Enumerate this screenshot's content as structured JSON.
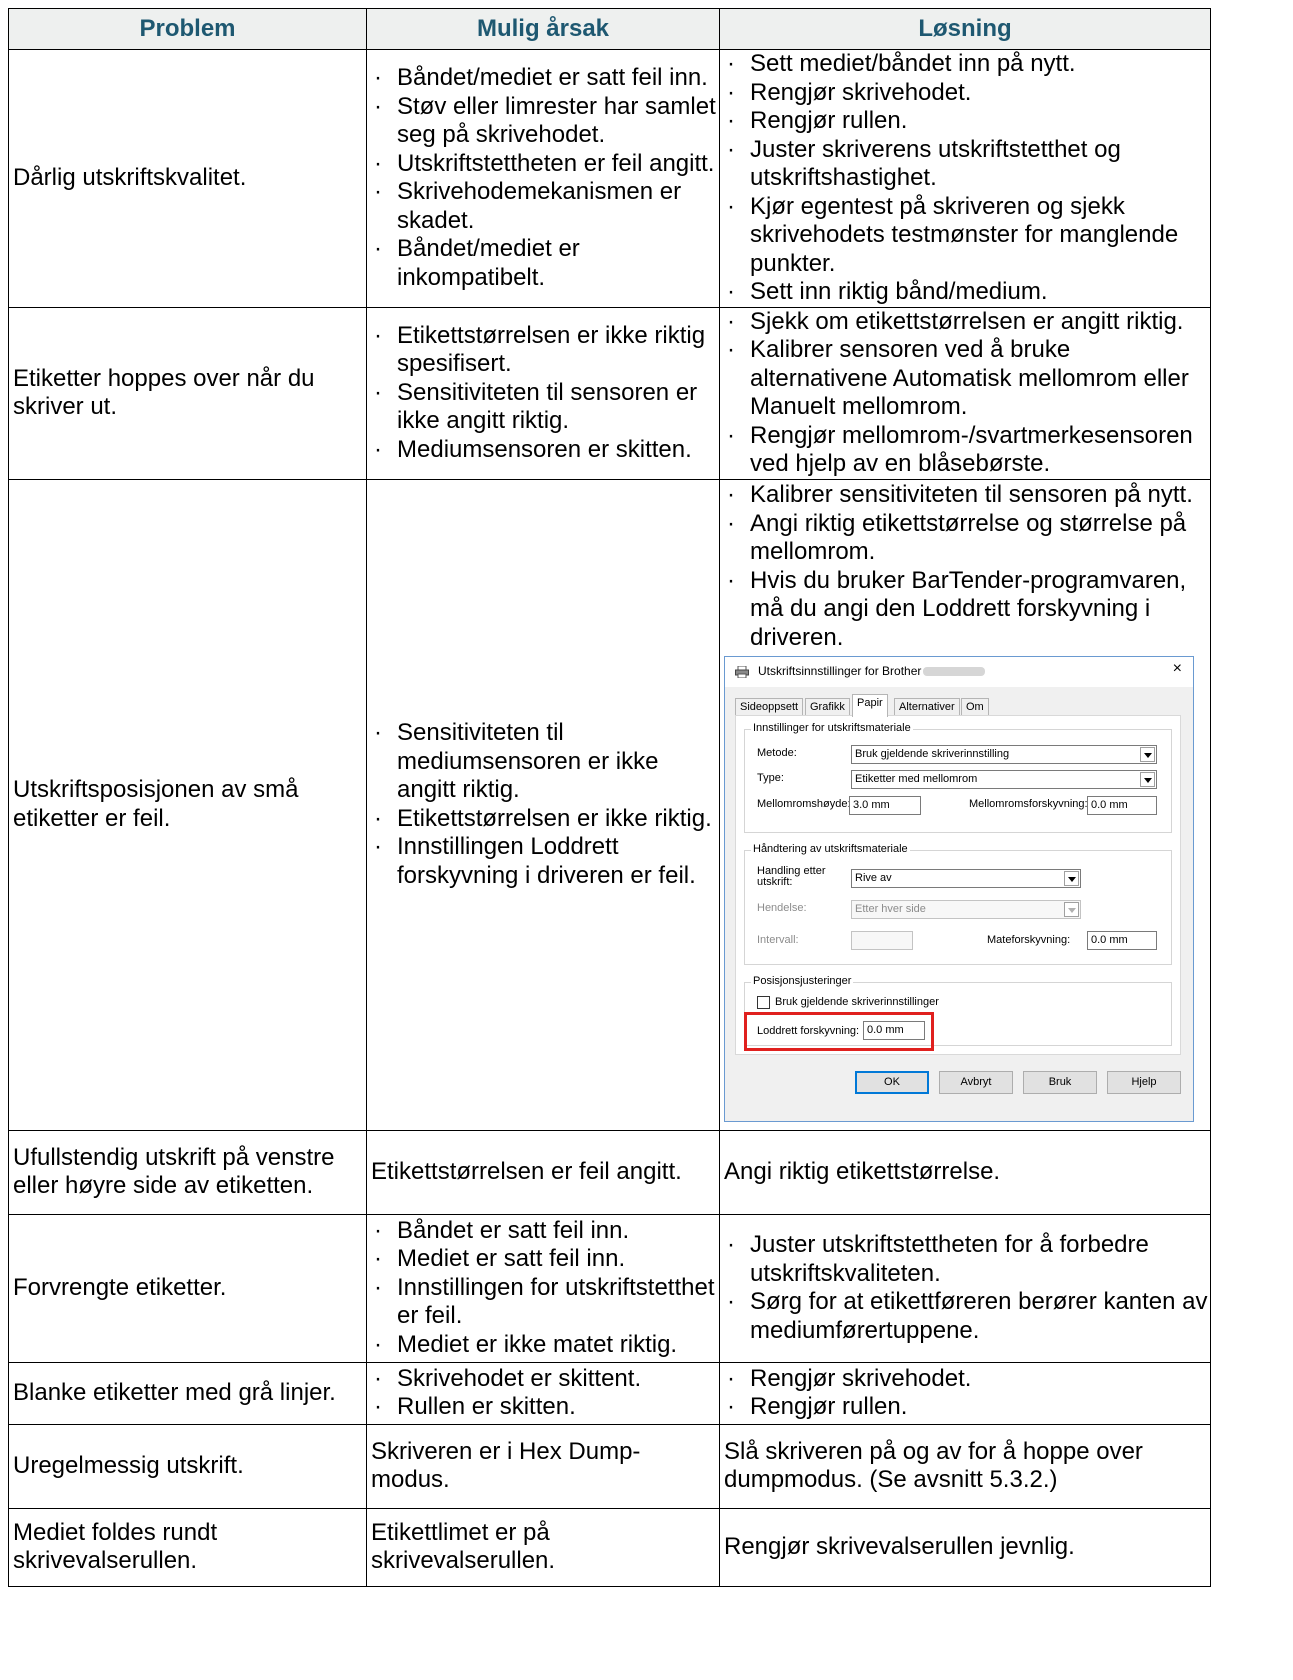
{
  "headers": {
    "problem": "Problem",
    "cause": "Mulig årsak",
    "solution": "Løsning"
  },
  "rows": [
    {
      "problem": "Dårlig utskriftskvalitet.",
      "causes": [
        "Båndet/mediet er satt feil inn.",
        "Støv eller limrester har samlet seg på skrivehodet.",
        "Utskriftstettheten er feil angitt.",
        "Skrivehodemekanismen er skadet.",
        "Båndet/mediet er inkompatibelt."
      ],
      "solutions": [
        "Sett mediet/båndet inn på nytt.",
        "Rengjør skrivehodet.",
        "Rengjør rullen.",
        "Juster skriverens utskriftstetthet og utskriftshastighet.",
        "Kjør egentest på skriveren og sjekk skrivehodets testmønster for manglende punkter.",
        "Sett inn riktig bånd/medium."
      ]
    },
    {
      "problem": "Etiketter hoppes over når du skriver ut.",
      "causes": [
        "Etikettstørrelsen er ikke riktig spesifisert.",
        "Sensitiviteten til sensoren er ikke angitt riktig.",
        "Mediumsensoren er skitten."
      ],
      "solutions": [
        "Sjekk om etikettstørrelsen er angitt riktig.",
        "Kalibrer sensoren ved å bruke alternativene Automatisk mellomrom eller Manuelt mellomrom.",
        "Rengjør mellomrom-/svartmerkesensoren ved hjelp av en blåsebørste."
      ]
    },
    {
      "problem": "Utskriftsposisjonen av små etiketter er feil.",
      "causes": [
        "Sensitiviteten til mediumsensoren er ikke angitt riktig.",
        "Etikettstørrelsen er ikke riktig.",
        "Innstillingen Loddrett forskyvning i driveren er feil."
      ],
      "solutions": [
        "Kalibrer sensitiviteten til sensoren på nytt.",
        "Angi riktig etikettstørrelse og størrelse på mellomrom.",
        "Hvis du bruker BarTender-programvaren, må du angi den Loddrett forskyvning i driveren."
      ]
    },
    {
      "problem": "Ufullstendig utskrift på venstre eller høyre side av etiketten.",
      "cause_text": "Etikettstørrelsen er feil angitt.",
      "solution_text": "Angi riktig etikettstørrelse."
    },
    {
      "problem": "Forvrengte etiketter.",
      "causes": [
        "Båndet er satt feil inn.",
        "Mediet er satt feil inn.",
        "Innstillingen for utskriftstetthet er feil.",
        "Mediet er ikke matet riktig."
      ],
      "solutions": [
        "Juster utskriftstettheten for å forbedre utskriftskvaliteten.",
        "Sørg for at etikettføreren berører kanten av mediumførertuppene."
      ]
    },
    {
      "problem": "Blanke etiketter med grå linjer.",
      "causes": [
        "Skrivehodet er skittent.",
        "Rullen er skitten."
      ],
      "solutions": [
        "Rengjør skrivehodet.",
        "Rengjør rullen."
      ]
    },
    {
      "problem": "Uregelmessig utskrift.",
      "cause_text": "Skriveren er i Hex Dump-modus.",
      "solution_text": "Slå skriveren på og av for å hoppe over dumpmodus. (Se avsnitt 5.3.2.)"
    },
    {
      "problem": "Mediet foldes rundt skrivevalserullen.",
      "cause_text": "Etikettlimet er på skrivevalserullen.",
      "solution_text": "Rengjør skrivevalserullen jevnlig."
    }
  ],
  "dialog": {
    "title": "Utskriftsinnstillinger for Brother",
    "close": "×",
    "tabs": [
      "Sideoppsett",
      "Grafikk",
      "Papir",
      "Alternativer",
      "Om"
    ],
    "active_tab": "Papir",
    "group_media": "Innstillinger for utskriftsmateriale",
    "method_label": "Metode:",
    "method_value": "Bruk gjeldende skriverinnstilling",
    "type_label": "Type:",
    "type_value": "Etiketter med mellomrom",
    "gap_height_label": "Mellomromshøyde:",
    "gap_height_value": "3.0 mm",
    "gap_offset_label": "Mellomromsforskyvning:",
    "gap_offset_value": "0.0 mm",
    "group_handling": "Håndtering av utskriftsmateriale",
    "post_action_label": "Handling etter utskrift:",
    "post_action_value": "Rive av",
    "event_label": "Hendelse:",
    "event_value": "Etter hver side",
    "interval_label": "Intervall:",
    "interval_value": "",
    "feed_offset_label": "Mateforskyvning:",
    "feed_offset_value": "0.0 mm",
    "group_position": "Posisjonsjusteringer",
    "use_current_label": "Bruk gjeldende skriverinnstillinger",
    "vertical_offset_label": "Loddrett forskyvning:",
    "vertical_offset_value": "0.0 mm",
    "buttons": {
      "ok": "OK",
      "cancel": "Avbryt",
      "apply": "Bruk",
      "help": "Hjelp"
    },
    "highlight_color": "#e0201e"
  }
}
